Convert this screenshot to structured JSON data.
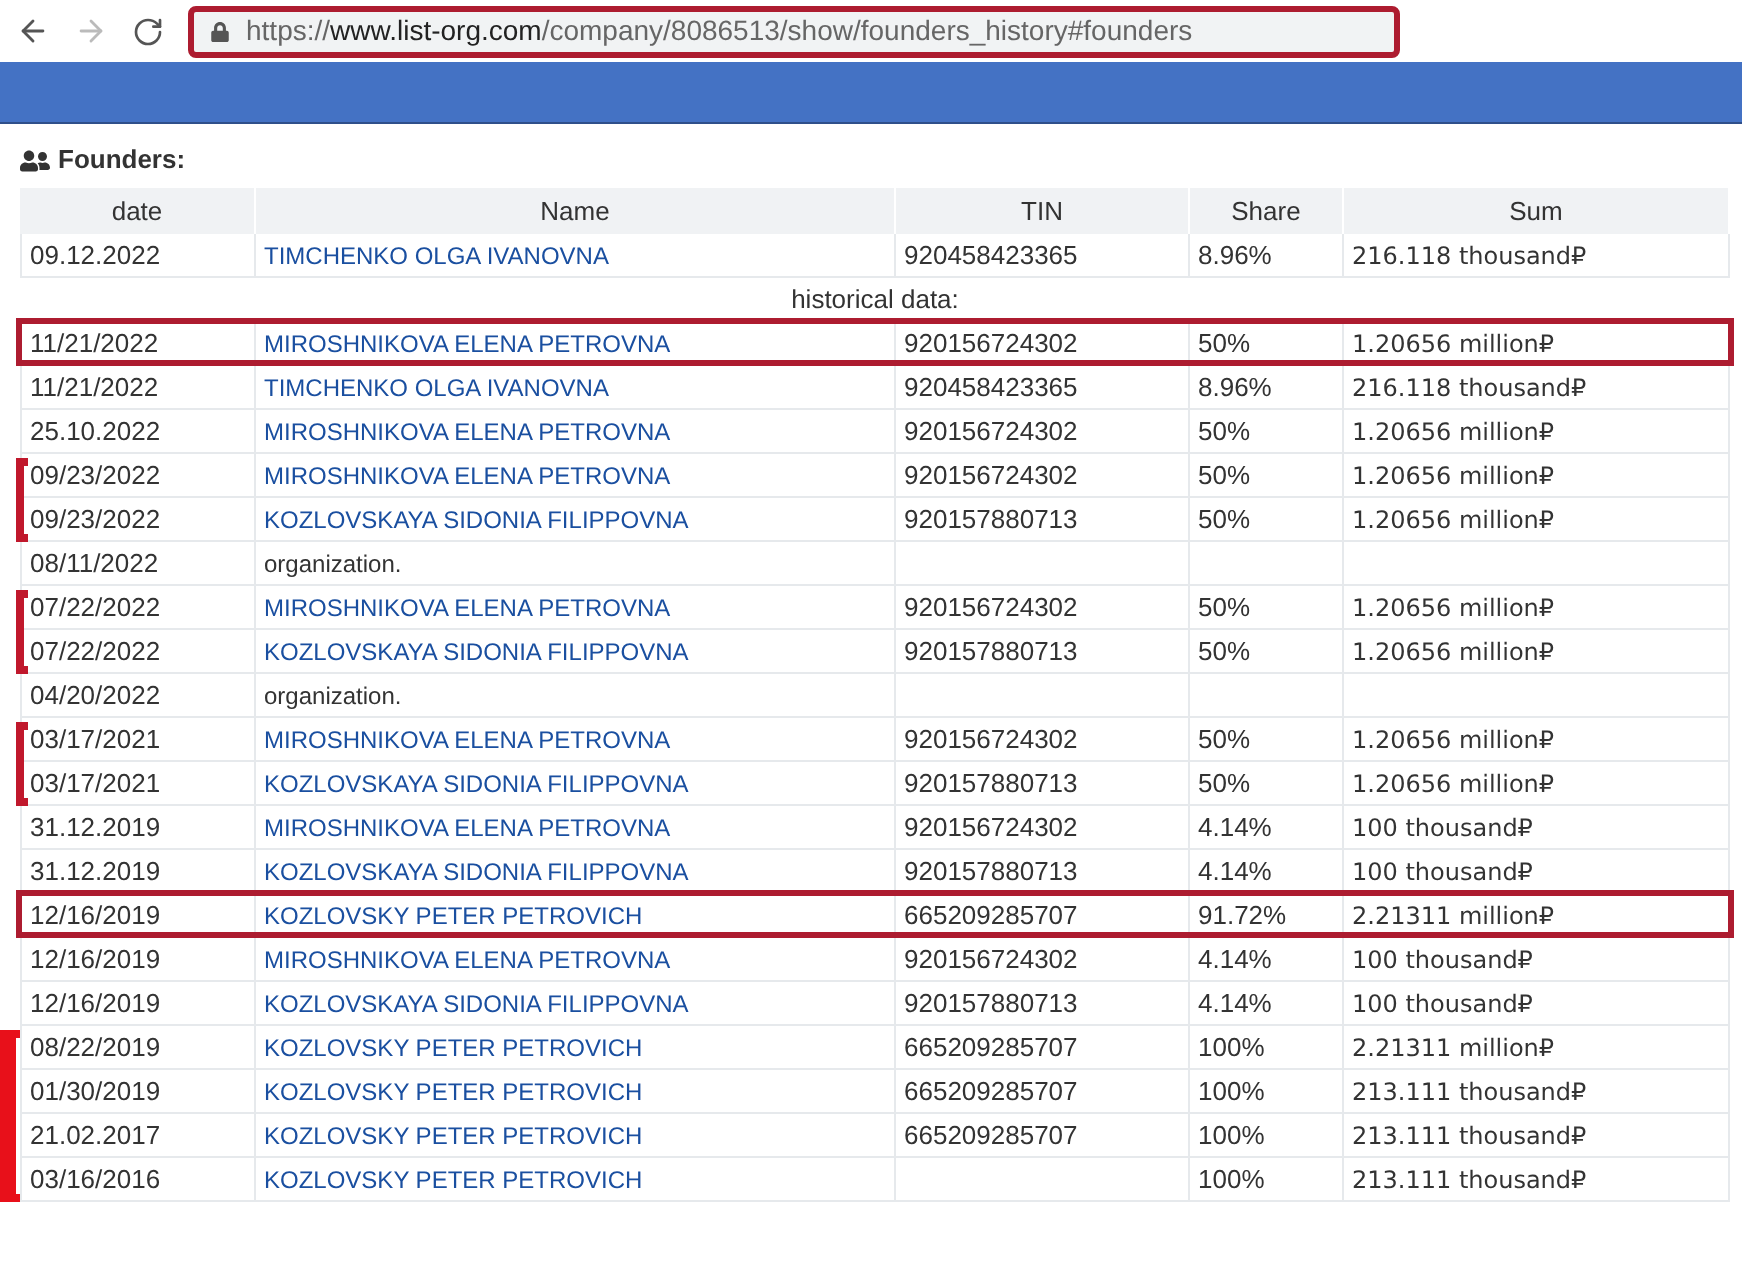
{
  "browser": {
    "url": {
      "scheme": "https://",
      "host": "www.list-org.com",
      "path": "/company/8086513/show/founders_history#founders"
    },
    "url_highlighted": true,
    "forward_disabled": true
  },
  "section": {
    "title": "Founders:"
  },
  "table": {
    "columns": [
      "date",
      "Name",
      "TIN",
      "Share",
      "Sum"
    ],
    "current_rows": [
      {
        "date": "09.12.2022",
        "name": "TIMCHENKO OLGA IVANOVNA",
        "kind": "person",
        "tin": "920458423365",
        "share": "8.96%",
        "sum": "216.118 thousand₽",
        "highlighted": false
      }
    ],
    "historical_label": "historical data:",
    "historical_rows": [
      {
        "date": "11/21/2022",
        "name": "MIROSHNIKOVA ELENA PETROVNA",
        "kind": "person",
        "tin": "920156724302",
        "share": "50%",
        "sum": "1.20656 million₽",
        "highlighted": true,
        "bracket_start": false,
        "bracket_end": false
      },
      {
        "date": "11/21/2022",
        "name": "TIMCHENKO OLGA IVANOVNA",
        "kind": "person",
        "tin": "920458423365",
        "share": "8.96%",
        "sum": "216.118 thousand₽",
        "highlighted": false,
        "bracket_start": false,
        "bracket_end": false
      },
      {
        "date": "25.10.2022",
        "name": "MIROSHNIKOVA ELENA PETROVNA",
        "kind": "person",
        "tin": "920156724302",
        "share": "50%",
        "sum": "1.20656 million₽",
        "highlighted": false,
        "bracket_start": false,
        "bracket_end": false
      },
      {
        "date": "09/23/2022",
        "name": "MIROSHNIKOVA ELENA PETROVNA",
        "kind": "person",
        "tin": "920156724302",
        "share": "50%",
        "sum": "1.20656 million₽",
        "highlighted": false,
        "bracket_start": true,
        "bracket_end": false
      },
      {
        "date": "09/23/2022",
        "name": "KOZLOVSKAYA SIDONIA FILIPPOVNA",
        "kind": "person",
        "tin": "920157880713",
        "share": "50%",
        "sum": "1.20656 million₽",
        "highlighted": false,
        "bracket_start": false,
        "bracket_end": true
      },
      {
        "date": "08/11/2022",
        "name": "organization.",
        "kind": "organization",
        "highlighted": false,
        "bracket_start": false,
        "bracket_end": false
      },
      {
        "date": "07/22/2022",
        "name": "MIROSHNIKOVA ELENA PETROVNA",
        "kind": "person",
        "tin": "920156724302",
        "share": "50%",
        "sum": "1.20656 million₽",
        "highlighted": false,
        "bracket_start": true,
        "bracket_end": false
      },
      {
        "date": "07/22/2022",
        "name": "KOZLOVSKAYA SIDONIA FILIPPOVNA",
        "kind": "person",
        "tin": "920157880713",
        "share": "50%",
        "sum": "1.20656 million₽",
        "highlighted": false,
        "bracket_start": false,
        "bracket_end": true
      },
      {
        "date": "04/20/2022",
        "name": "organization.",
        "kind": "organization",
        "highlighted": false,
        "bracket_start": false,
        "bracket_end": false
      },
      {
        "date": "03/17/2021",
        "name": "MIROSHNIKOVA ELENA PETROVNA",
        "kind": "person",
        "tin": "920156724302",
        "share": "50%",
        "sum": "1.20656 million₽",
        "highlighted": false,
        "bracket_start": true,
        "bracket_end": false
      },
      {
        "date": "03/17/2021",
        "name": "KOZLOVSKAYA SIDONIA FILIPPOVNA",
        "kind": "person",
        "tin": "920157880713",
        "share": "50%",
        "sum": "1.20656 million₽",
        "highlighted": false,
        "bracket_start": false,
        "bracket_end": true
      },
      {
        "date": "31.12.2019",
        "name": "MIROSHNIKOVA ELENA PETROVNA",
        "kind": "person",
        "tin": "920156724302",
        "share": "4.14%",
        "sum": "100 thousand₽",
        "highlighted": false,
        "bracket_start": false,
        "bracket_end": false
      },
      {
        "date": "31.12.2019",
        "name": "KOZLOVSKAYA SIDONIA FILIPPOVNA",
        "kind": "person",
        "tin": "920157880713",
        "share": "4.14%",
        "sum": "100 thousand₽",
        "highlighted": false,
        "bracket_start": false,
        "bracket_end": false
      },
      {
        "date": "12/16/2019",
        "name": "KOZLOVSKY PETER PETROVICH",
        "kind": "person",
        "tin": "665209285707",
        "share": "91.72%",
        "sum": "2.21311 million₽",
        "highlighted": true,
        "bracket_start": false,
        "bracket_end": false
      },
      {
        "date": "12/16/2019",
        "name": "MIROSHNIKOVA ELENA PETROVNA",
        "kind": "person",
        "tin": "920156724302",
        "share": "4.14%",
        "sum": "100 thousand₽",
        "highlighted": false,
        "bracket_start": false,
        "bracket_end": false
      },
      {
        "date": "12/16/2019",
        "name": "KOZLOVSKAYA SIDONIA FILIPPOVNA",
        "kind": "person",
        "tin": "920157880713",
        "share": "4.14%",
        "sum": "100 thousand₽",
        "highlighted": false,
        "bracket_start": false,
        "bracket_end": false
      },
      {
        "date": "08/22/2019",
        "name": "KOZLOVSKY PETER PETROVICH",
        "kind": "person",
        "tin": "665209285707",
        "share": "100%",
        "sum": "2.21311 million₽",
        "highlighted": false,
        "bracket_start": true,
        "bracket_end": false
      },
      {
        "date": "01/30/2019",
        "name": "KOZLOVSKY PETER PETROVICH",
        "kind": "person",
        "tin": "665209285707",
        "share": "100%",
        "sum": "213.111 thousand₽",
        "highlighted": false,
        "bracket_start": false,
        "bracket_end": false
      },
      {
        "date": "21.02.2017",
        "name": "KOZLOVSKY PETER PETROVICH",
        "kind": "person",
        "tin": "665209285707",
        "share": "100%",
        "sum": "213.111 thousand₽",
        "highlighted": false,
        "bracket_start": false,
        "bracket_end": false
      },
      {
        "date": "03/16/2016",
        "name": "KOZLOVSKY PETER PETROVICH",
        "kind": "person",
        "share": "100%",
        "sum": "213.111 thousand₽",
        "highlighted": false,
        "bracket_start": false,
        "bracket_end": true
      }
    ]
  }
}
